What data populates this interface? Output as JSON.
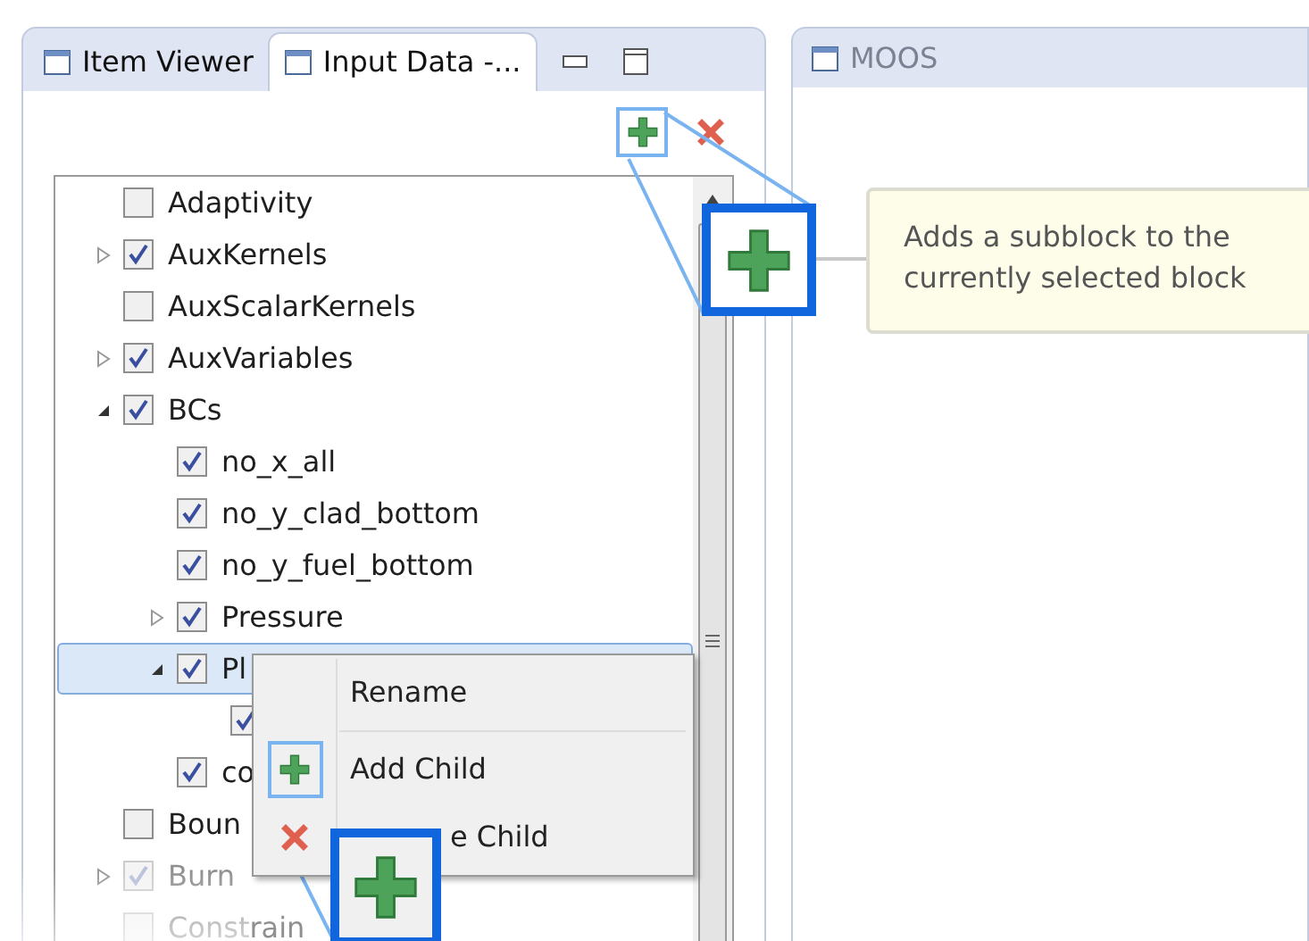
{
  "tabs": [
    {
      "label": "Item Viewer",
      "selected": false
    },
    {
      "label": "Input Data -...",
      "selected": true
    }
  ],
  "right_tab": {
    "label": "MOOS"
  },
  "tree": [
    {
      "label": "Adaptivity",
      "checked": false,
      "disabled": false,
      "selected": false
    },
    {
      "label": "AuxKernels",
      "checked": true,
      "disabled": false,
      "selected": false,
      "expanded": false
    },
    {
      "label": "AuxScalarKernels",
      "checked": false,
      "disabled": false,
      "selected": false
    },
    {
      "label": "AuxVariables",
      "checked": true,
      "disabled": false,
      "selected": false,
      "expanded": false
    },
    {
      "label": "BCs",
      "checked": true,
      "disabled": false,
      "selected": false,
      "expanded": true,
      "children": [
        {
          "label": "no_x_all",
          "checked": true,
          "disabled": false,
          "selected": false
        },
        {
          "label": "no_y_clad_bottom",
          "checked": true,
          "disabled": false,
          "selected": false
        },
        {
          "label": "no_y_fuel_bottom",
          "checked": true,
          "disabled": false,
          "selected": false
        },
        {
          "label": "Pressure",
          "checked": true,
          "disabled": false,
          "selected": false,
          "expanded": false
        },
        {
          "label": "Pl",
          "checked": true,
          "disabled": false,
          "selected": true,
          "expanded": true,
          "children": [
            {
              "checked": true,
              "disabled": false,
              "selected": false
            }
          ]
        },
        {
          "label": "co",
          "checked": true,
          "disabled": false,
          "selected": false
        }
      ]
    },
    {
      "label": "Boun",
      "checked": false,
      "disabled": false,
      "selected": false
    },
    {
      "label": "Burn",
      "checked": true,
      "disabled": true,
      "selected": false,
      "expanded": false
    },
    {
      "label": "Constrain",
      "checked": false,
      "disabled": true,
      "selected": false
    }
  ],
  "context_menu": [
    {
      "kind": "plain",
      "label": "Rename"
    },
    {
      "kind": "add",
      "label": "Add Child"
    },
    {
      "kind": "remove",
      "label": "e Child"
    }
  ],
  "tooltip": {
    "text": "Adds a subblock to the currently selected block"
  }
}
